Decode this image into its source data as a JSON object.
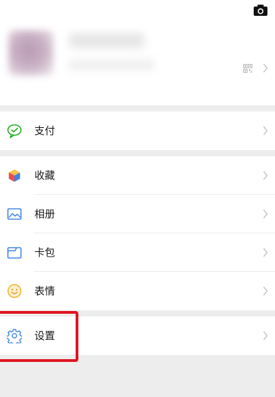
{
  "profile": {
    "camera_icon": "camera-icon",
    "qr_icon": "qr-code-icon",
    "chevron_icon": "chevron-right-icon"
  },
  "menu": {
    "pay": {
      "label": "支付",
      "icon": "wechat-pay-icon"
    },
    "favorites": {
      "label": "收藏",
      "icon": "cube-icon"
    },
    "album": {
      "label": "相册",
      "icon": "photo-album-icon"
    },
    "cards": {
      "label": "卡包",
      "icon": "card-wallet-icon"
    },
    "stickers": {
      "label": "表情",
      "icon": "smiley-icon"
    },
    "settings": {
      "label": "设置",
      "icon": "gear-icon"
    }
  },
  "colors": {
    "background": "#ededed",
    "surface": "#ffffff",
    "pay_green": "#1aad19",
    "highlight_red": "#e0141e"
  }
}
